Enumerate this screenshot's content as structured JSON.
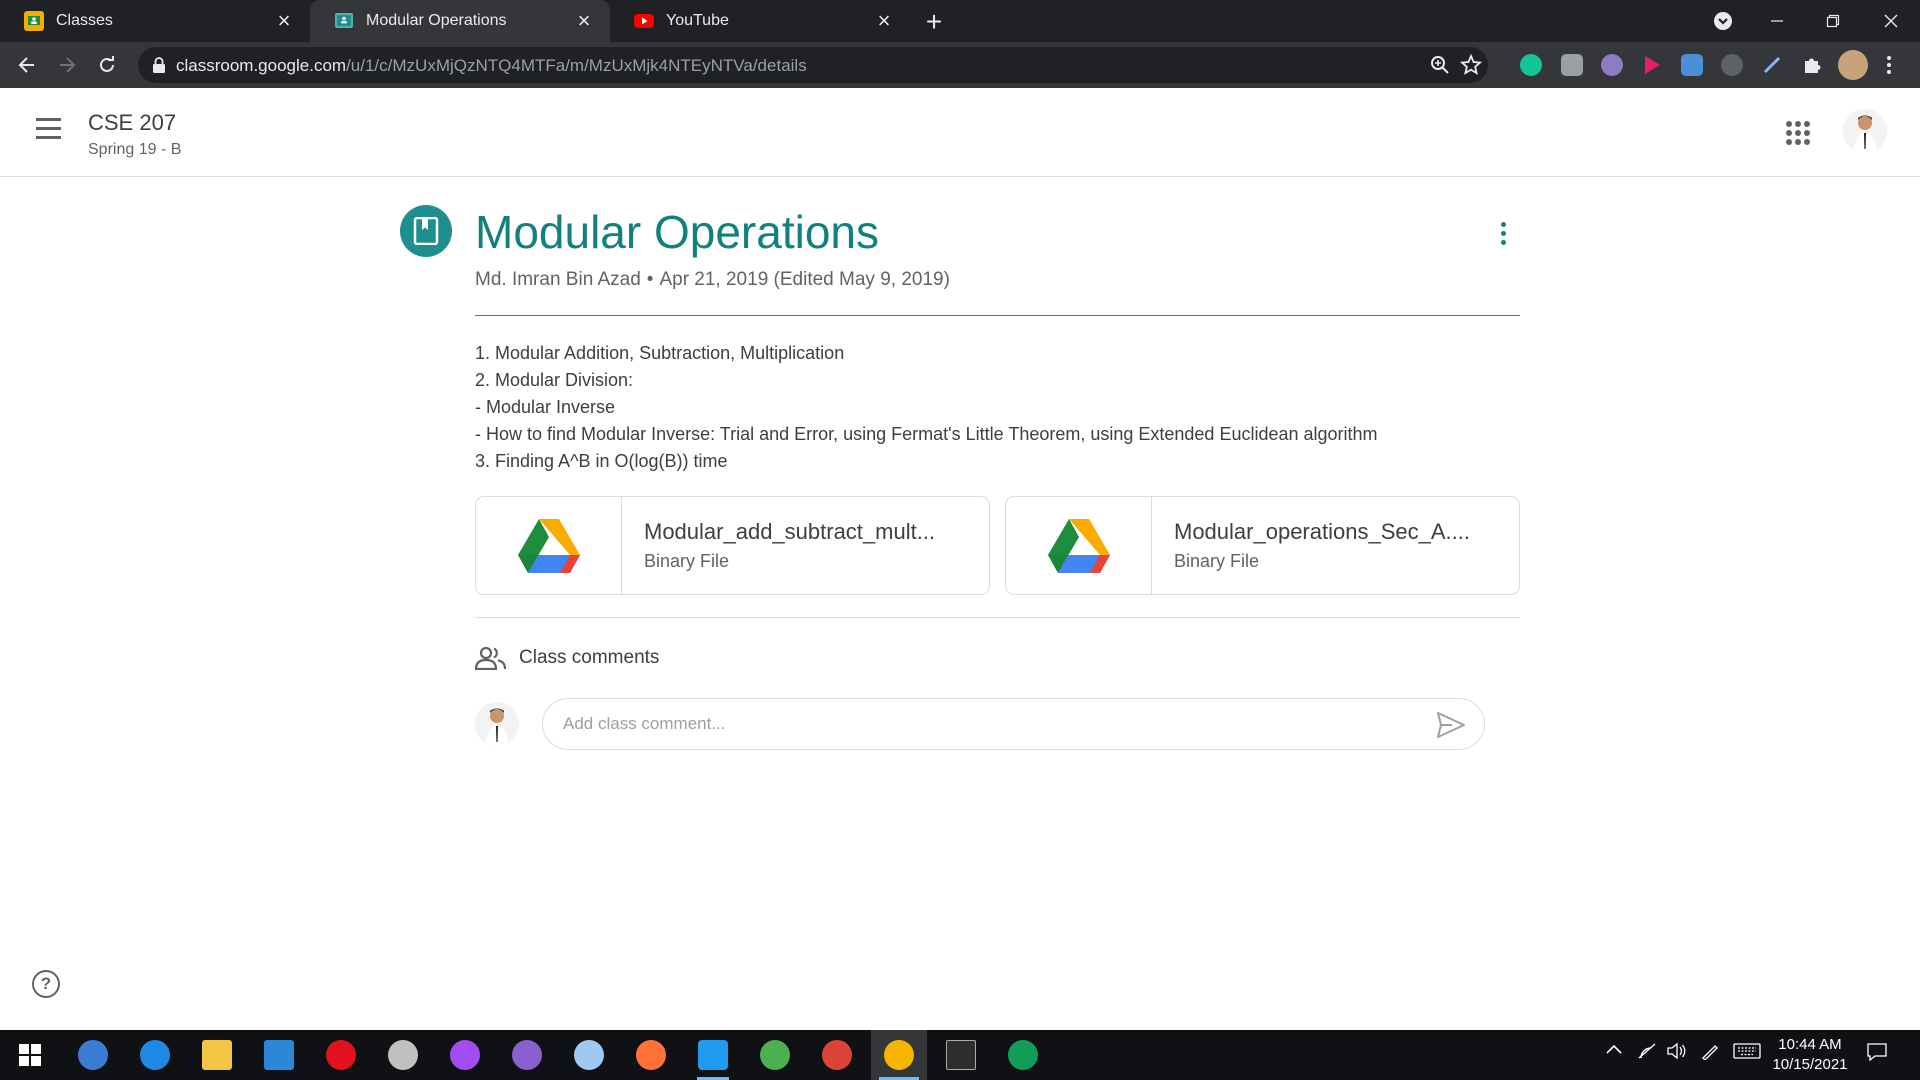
{
  "browser": {
    "tabs": [
      {
        "title": "Classes",
        "favicon": "classroom-icon",
        "active": false
      },
      {
        "title": "Modular Operations",
        "favicon": "classroom-icon",
        "active": true
      },
      {
        "title": "YouTube",
        "favicon": "youtube-icon",
        "active": false
      }
    ],
    "url_host": "classroom.google.com",
    "url_path": "/u/1/c/MzUxMjQzNTQ4MTFa/m/MzUxMjk4NTEyNTVa/details"
  },
  "course": {
    "title": "CSE 207",
    "section": "Spring 19 - B"
  },
  "post": {
    "title": "Modular Operations",
    "author": "Md. Imran Bin Azad",
    "separator": "•",
    "date": "Apr 21, 2019 (Edited May 9, 2019)",
    "description": [
      "1. Modular Addition, Subtraction, Multiplication",
      "2. Modular Division:",
      "- Modular Inverse",
      "- How to find Modular Inverse: Trial and Error, using Fermat's Little Theorem, using Extended Euclidean algorithm",
      "3. Finding A^B in O(log(B)) time"
    ],
    "attachments": [
      {
        "name": "Modular_add_subtract_mult...",
        "type": "Binary File"
      },
      {
        "name": "Modular_operations_Sec_A....",
        "type": "Binary File"
      }
    ]
  },
  "comments": {
    "label": "Class comments",
    "placeholder": "Add class comment..."
  },
  "help": {
    "symbol": "?"
  },
  "taskbar": {
    "time": "10:44 AM",
    "date": "10/15/2021"
  },
  "colors": {
    "accent": "#12807e",
    "chrome_dark": "#202124",
    "chrome_toolbar": "#35363a"
  }
}
